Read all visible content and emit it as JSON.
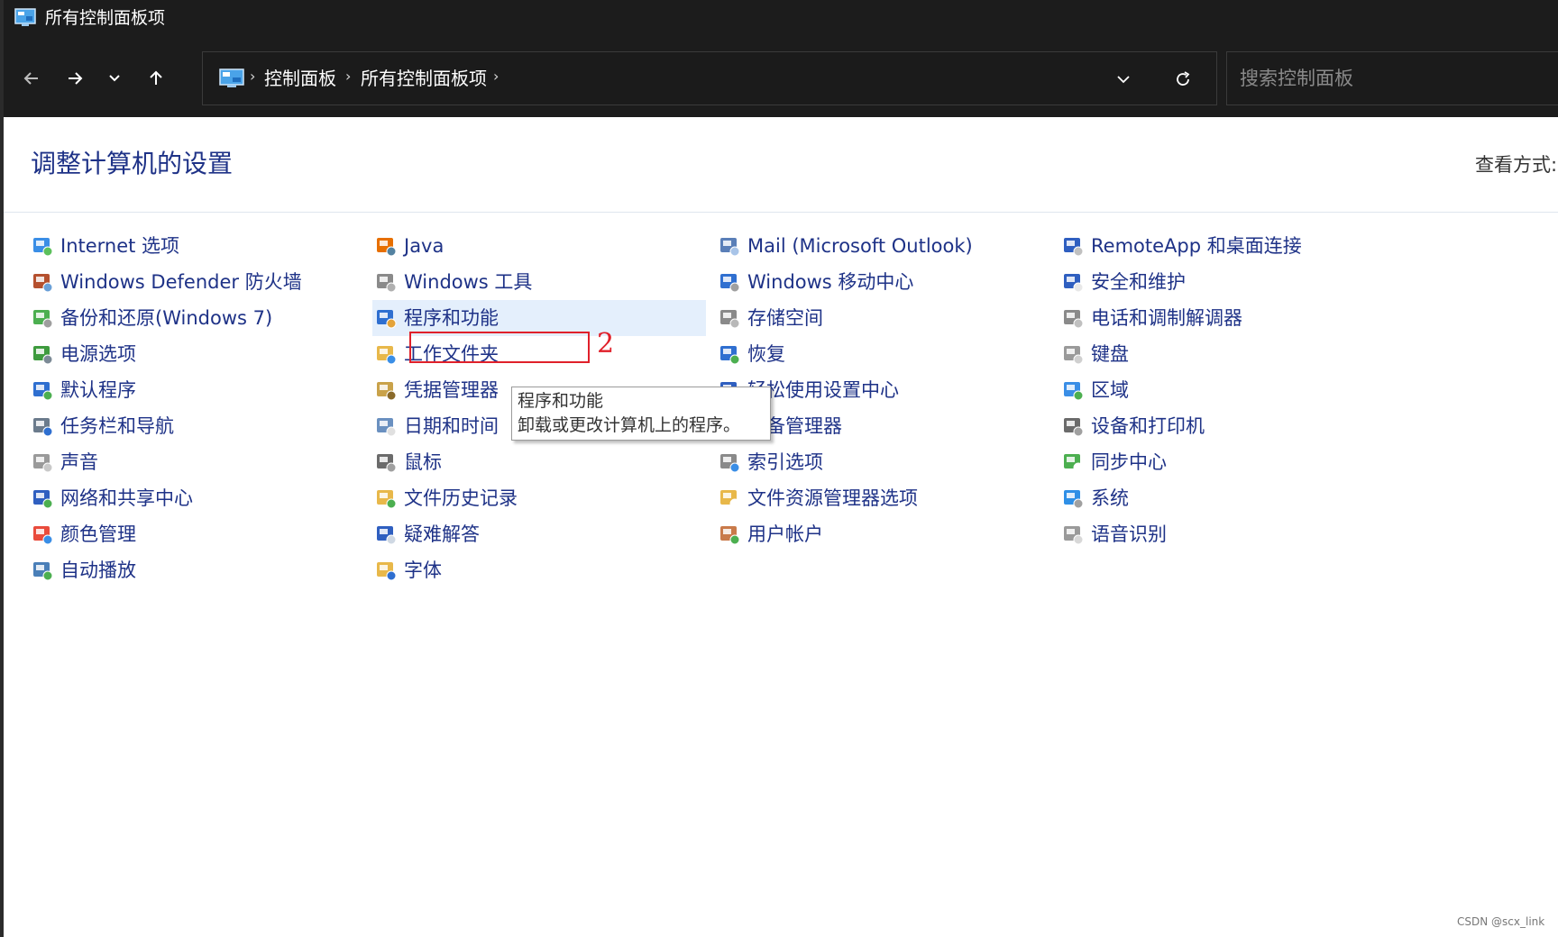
{
  "window": {
    "title": "所有控制面板项"
  },
  "nav": {
    "back": "back-arrow-icon",
    "forward": "forward-arrow-icon",
    "recent": "chevron-down-icon",
    "up": "up-arrow-icon"
  },
  "address": {
    "crumbs": [
      "控制面板",
      "所有控制面板项"
    ],
    "separator": "›"
  },
  "search": {
    "placeholder": "搜索控制面板"
  },
  "page": {
    "title": "调整计算机的设置",
    "view_by": "查看方式:"
  },
  "columns": [
    {
      "items": [
        {
          "label": "Internet 选项",
          "icon": "internet-options-icon"
        },
        {
          "label": "Windows Defender 防火墙",
          "icon": "firewall-icon"
        },
        {
          "label": "备份和还原(Windows 7)",
          "icon": "backup-restore-icon"
        },
        {
          "label": "电源选项",
          "icon": "power-options-icon"
        },
        {
          "label": "默认程序",
          "icon": "default-programs-icon"
        },
        {
          "label": "任务栏和导航",
          "icon": "taskbar-icon"
        },
        {
          "label": "声音",
          "icon": "sound-icon"
        },
        {
          "label": "网络和共享中心",
          "icon": "network-icon"
        },
        {
          "label": "颜色管理",
          "icon": "color-management-icon"
        },
        {
          "label": "自动播放",
          "icon": "autoplay-icon"
        }
      ]
    },
    {
      "items": [
        {
          "label": "Java",
          "icon": "java-icon"
        },
        {
          "label": "Windows 工具",
          "icon": "windows-tools-icon"
        },
        {
          "label": "程序和功能",
          "icon": "programs-features-icon"
        },
        {
          "label": "工作文件夹",
          "icon": "work-folders-icon"
        },
        {
          "label": "凭据管理器",
          "icon": "credential-manager-icon"
        },
        {
          "label": "日期和时间",
          "icon": "date-time-icon"
        },
        {
          "label": "鼠标",
          "icon": "mouse-icon"
        },
        {
          "label": "文件历史记录",
          "icon": "file-history-icon"
        },
        {
          "label": "疑难解答",
          "icon": "troubleshooting-icon"
        },
        {
          "label": "字体",
          "icon": "fonts-icon"
        }
      ]
    },
    {
      "items": [
        {
          "label": "Mail (Microsoft Outlook)",
          "icon": "mail-icon"
        },
        {
          "label": "Windows 移动中心",
          "icon": "mobility-center-icon"
        },
        {
          "label": "存储空间",
          "icon": "storage-spaces-icon"
        },
        {
          "label": "恢复",
          "icon": "recovery-icon"
        },
        {
          "label": "轻松使用设置中心",
          "icon": "ease-of-access-icon"
        },
        {
          "label": "设备管理器",
          "icon": "device-manager-icon"
        },
        {
          "label": "索引选项",
          "icon": "indexing-options-icon"
        },
        {
          "label": "文件资源管理器选项",
          "icon": "explorer-options-icon"
        },
        {
          "label": "用户帐户",
          "icon": "user-accounts-icon"
        }
      ]
    },
    {
      "items": [
        {
          "label": "RemoteApp 和桌面连接",
          "icon": "remoteapp-icon"
        },
        {
          "label": "安全和维护",
          "icon": "security-maintenance-icon"
        },
        {
          "label": "电话和调制解调器",
          "icon": "phone-modem-icon"
        },
        {
          "label": "键盘",
          "icon": "keyboard-icon"
        },
        {
          "label": "区域",
          "icon": "region-icon"
        },
        {
          "label": "设备和打印机",
          "icon": "devices-printers-icon"
        },
        {
          "label": "同步中心",
          "icon": "sync-center-icon"
        },
        {
          "label": "系统",
          "icon": "system-icon"
        },
        {
          "label": "语音识别",
          "icon": "speech-recognition-icon"
        }
      ]
    }
  ],
  "annotation": {
    "number": "2"
  },
  "tooltip": {
    "title": "程序和功能",
    "description": "卸载或更改计算机上的程序。"
  },
  "watermark": "CSDN @scx_link",
  "colors": {
    "link": "#1e3287",
    "titlebar": "#1c1c1c",
    "hover": "#e4effc",
    "highlight_box": "#e0202a"
  }
}
